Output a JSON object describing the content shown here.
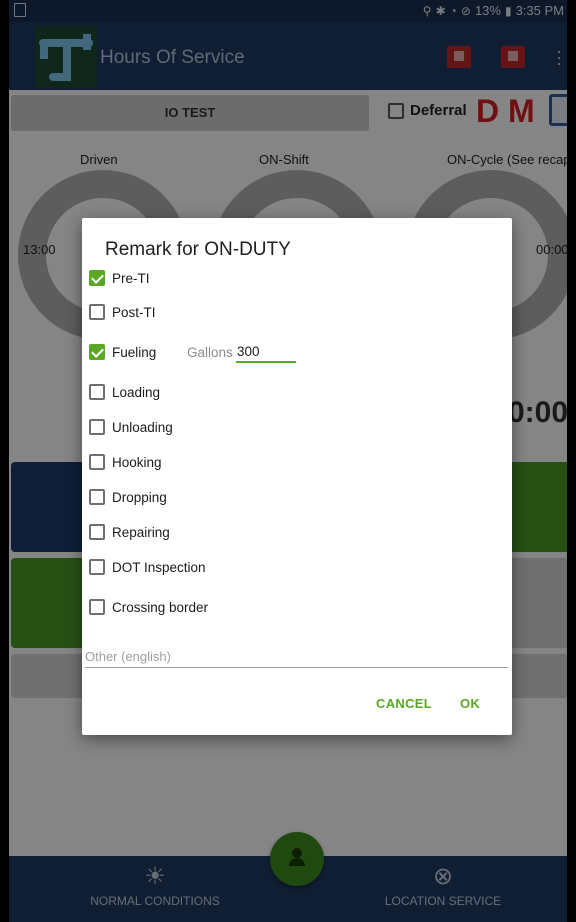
{
  "status_bar": {
    "battery": "13%",
    "time": "3:35 PM",
    "icons": [
      "location-icon",
      "bluetooth-icon",
      "wifi-icon",
      "do-not-disturb-icon",
      "battery-icon"
    ]
  },
  "app_bar": {
    "title": "Hours Of Service",
    "actions": [
      "phone-device-icon",
      "truck-icon",
      "overflow-menu-icon"
    ]
  },
  "background": {
    "driver_name": "IO TEST",
    "deferral_label": "Deferral",
    "flag_d": "D",
    "flag_m": "M",
    "gauges": [
      {
        "label": "Driven",
        "time": "13:00"
      },
      {
        "label": "ON-Shift",
        "time": ""
      },
      {
        "label": "ON-Cycle (See recap)",
        "time": "00:00"
      }
    ],
    "big_time_fragment": "0:00"
  },
  "dialog": {
    "title": "Remark for ON-DUTY",
    "options": [
      {
        "label": "Pre-TI",
        "checked": true
      },
      {
        "label": "Post-TI",
        "checked": false
      },
      {
        "label": "Fueling",
        "checked": true
      },
      {
        "label": "Loading",
        "checked": false
      },
      {
        "label": "Unloading",
        "checked": false
      },
      {
        "label": "Hooking",
        "checked": false
      },
      {
        "label": "Dropping",
        "checked": false
      },
      {
        "label": "Repairing",
        "checked": false
      },
      {
        "label": "DOT Inspection",
        "checked": false
      },
      {
        "label": "Crossing border",
        "checked": false
      }
    ],
    "gallons_label": "Gallons",
    "gallons_value": "300",
    "other_placeholder": "Other (english)",
    "cancel_label": "CANCEL",
    "ok_label": "OK"
  },
  "bottom_nav": {
    "items": [
      {
        "label": "NORMAL CONDITIONS",
        "icon": "sun-icon"
      },
      {
        "label": "LOCATION SERVICE",
        "icon": "location-off-icon"
      }
    ],
    "fab_icon": "driver-person-icon"
  },
  "colors": {
    "app_bar": "#1f3a63",
    "accent_green": "#5aa825",
    "flag_red": "#d81f26"
  }
}
